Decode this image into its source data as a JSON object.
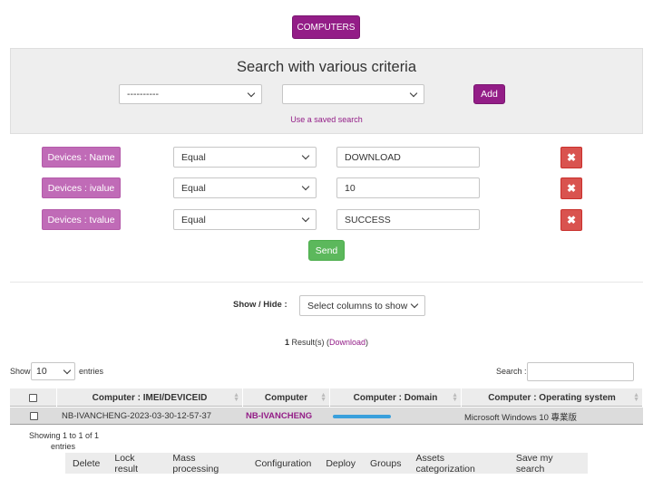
{
  "header": {
    "computers_button": "COMPUTERS"
  },
  "search_panel": {
    "title": "Search with various criteria",
    "field_select": "----------",
    "value_select": "",
    "add_label": "Add",
    "saved_search_link": "Use a saved search"
  },
  "criteria": [
    {
      "tag": "Devices : Name",
      "operator": "Equal",
      "value": "DOWNLOAD"
    },
    {
      "tag": "Devices : ivalue",
      "operator": "Equal",
      "value": "10"
    },
    {
      "tag": "Devices : tvalue",
      "operator": "Equal",
      "value": "SUCCESS"
    }
  ],
  "send_label": "Send",
  "columns_control": {
    "label": "Show / Hide :",
    "select": "Select columns to show"
  },
  "results": {
    "count": "1",
    "text": " Result(s) (",
    "download": "Download",
    "close": ")"
  },
  "length": {
    "show": "Show",
    "value": "10",
    "entries": "entries"
  },
  "search": {
    "label": "Search :",
    "value": ""
  },
  "table": {
    "headers": [
      "Computer : IMEI/DEVICEID",
      "Computer",
      "Computer : Domain",
      "Computer : Operating system"
    ],
    "rows": [
      {
        "imei": "NB-IVANCHENG-2023-03-30-12-57-37",
        "computer": "NB-IVANCHENG",
        "domain": "",
        "os": "Microsoft Windows 10 專業版"
      }
    ]
  },
  "info": {
    "line1": "Showing 1 to 1 of 1",
    "line2": "entries"
  },
  "actions": [
    "Delete",
    "Lock result",
    "Mass processing",
    "Configuration",
    "Deploy",
    "Groups",
    "Assets categorization",
    "Save my search"
  ],
  "colors": {
    "purple": "#931d87",
    "tag": "#c06bb7",
    "red": "#d9534f",
    "green": "#5cb85c",
    "redaction": "#3aa0dc"
  }
}
